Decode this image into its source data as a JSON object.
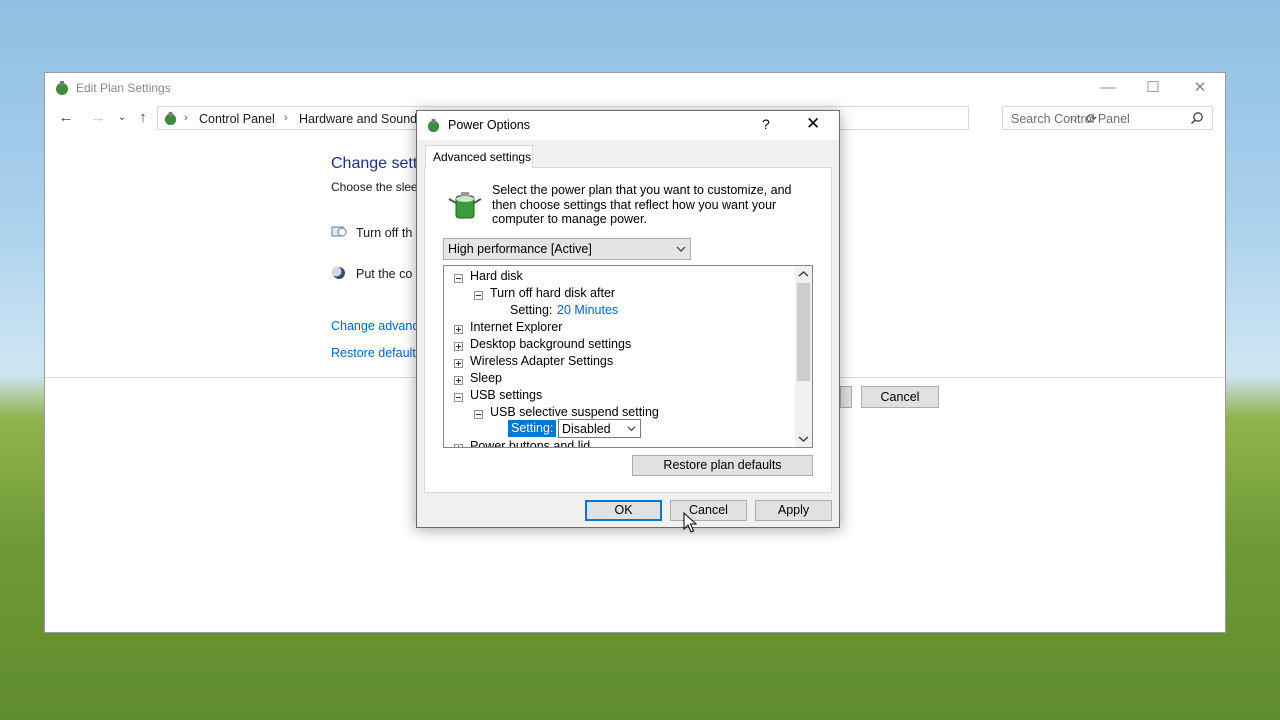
{
  "background_window": {
    "title": "Edit Plan Settings",
    "controls": {
      "minimize": "—",
      "maximize": "☐",
      "close": "✕"
    },
    "breadcrumb": [
      "Control Panel",
      "Hardware and Sound"
    ],
    "breadcrumb_separator": "›",
    "search_placeholder": "Search Control Panel",
    "heading": "Change sett",
    "subheading": "Choose the slee",
    "rows": [
      "Turn off th",
      "Put the co"
    ],
    "links": [
      "Change advanc",
      "Restore default"
    ],
    "cancel_label": "Cancel"
  },
  "dialog": {
    "title": "Power Options",
    "help": "?",
    "close": "✕",
    "tab": "Advanced settings",
    "intro": "Select the power plan that you want to customize, and then choose settings that reflect how you want your computer to manage power.",
    "plan_selected": "High performance [Active]",
    "tree": {
      "hard_disk": "Hard disk",
      "turn_off_hard_disk": "Turn off hard disk after",
      "setting_label": "Setting:",
      "hard_disk_value": "20 Minutes",
      "internet_explorer": "Internet Explorer",
      "desktop_background": "Desktop background settings",
      "wireless_adapter": "Wireless Adapter Settings",
      "sleep": "Sleep",
      "usb_settings": "USB settings",
      "usb_selective": "USB selective suspend setting",
      "usb_setting_label": "Setting:",
      "usb_value": "Disabled",
      "power_buttons": "Power buttons and lid"
    },
    "restore_defaults": "Restore plan defaults",
    "ok": "OK",
    "cancel": "Cancel",
    "apply": "Apply"
  },
  "colors": {
    "link": "#0066cc",
    "heading": "#1e3287",
    "selection": "#0078d7"
  }
}
